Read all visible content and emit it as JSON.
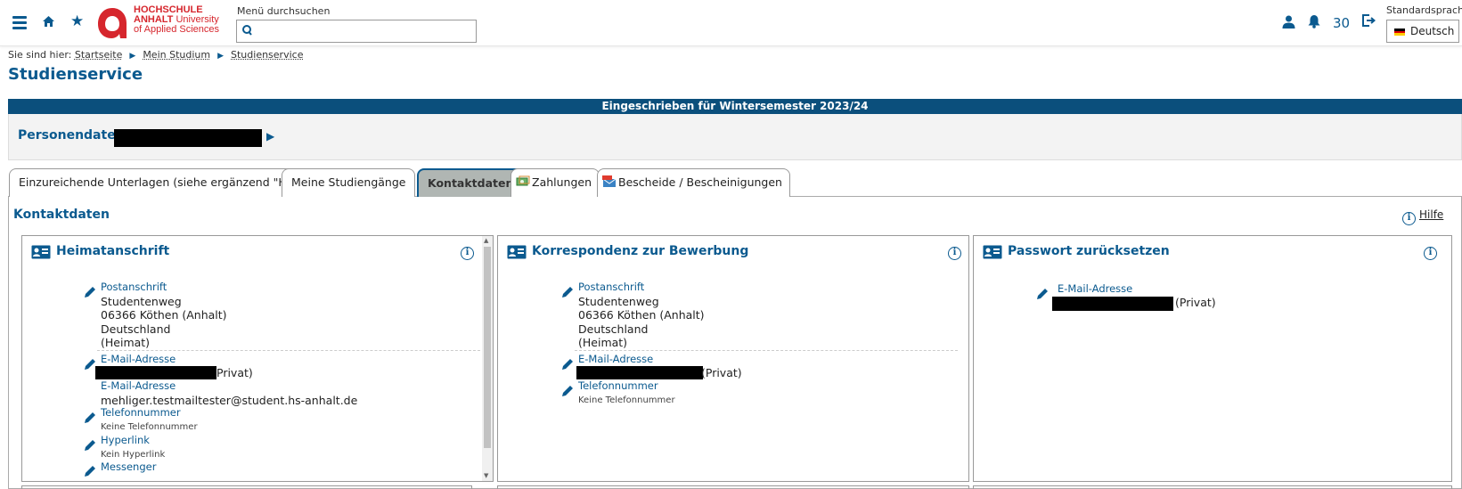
{
  "header": {
    "logo": {
      "line1": "HOCHSCHULE",
      "line2a": "ANHALT",
      "line2b": "University",
      "line3": "of Applied Sciences"
    },
    "search": {
      "label": "Menü durchsuchen",
      "value": "",
      "placeholder": ""
    },
    "notification_count": "30",
    "language": {
      "label": "Standardsprache",
      "value": "Deutsch"
    }
  },
  "breadcrumb": {
    "prefix": "Sie sind hier:",
    "items": [
      "Startseite",
      "Mein Studium",
      "Studienservice"
    ]
  },
  "page_title": "Studienservice",
  "enrollment": "Eingeschrieben für Wintersemester 2023/24",
  "person": {
    "label": "Personendaten:"
  },
  "tabs": [
    {
      "label": "Einzureichende Unterlagen (siehe ergänzend \"Hilfe\")"
    },
    {
      "label": "Meine Studiengänge"
    },
    {
      "label": "Kontaktdaten"
    },
    {
      "label": "Zahlungen"
    },
    {
      "label": "Bescheide / Bescheinigungen"
    }
  ],
  "content": {
    "title": "Kontaktdaten",
    "help": "Hilfe"
  },
  "cards": {
    "home": {
      "title": "Heimatanschrift",
      "address_label": "Postanschrift",
      "address": [
        "Studentenweg",
        "06366 Köthen (Anhalt)",
        "Deutschland",
        "(Heimat)"
      ],
      "email_label": "E-Mail-Adresse",
      "email_suffix": "Privat)",
      "email2_label": "E-Mail-Adresse",
      "email2_value": "mehliger.testmailtester@student.hs-anhalt.de",
      "phone_label": "Telefonnummer",
      "phone_value": "Keine Telefonnummer",
      "hyperlink_label": "Hyperlink",
      "hyperlink_value": "Kein Hyperlink",
      "messenger_label": "Messenger"
    },
    "correspondence": {
      "title": "Korrespondenz zur Bewerbung",
      "address_label": "Postanschrift",
      "address": [
        "Studentenweg",
        "06366 Köthen (Anhalt)",
        "Deutschland",
        "(Heimat)"
      ],
      "email_label": "E-Mail-Adresse",
      "email_suffix": "(Privat)",
      "phone_label": "Telefonnummer",
      "phone_value": "Keine Telefonnummer"
    },
    "password": {
      "title": "Passwort zurücksetzen",
      "email_label": "E-Mail-Adresse",
      "email_suffix": "(Privat)"
    }
  },
  "colors": {
    "primary": "#0b5a8f",
    "banner": "#0b4f7c",
    "brand_red": "#d6262d"
  }
}
